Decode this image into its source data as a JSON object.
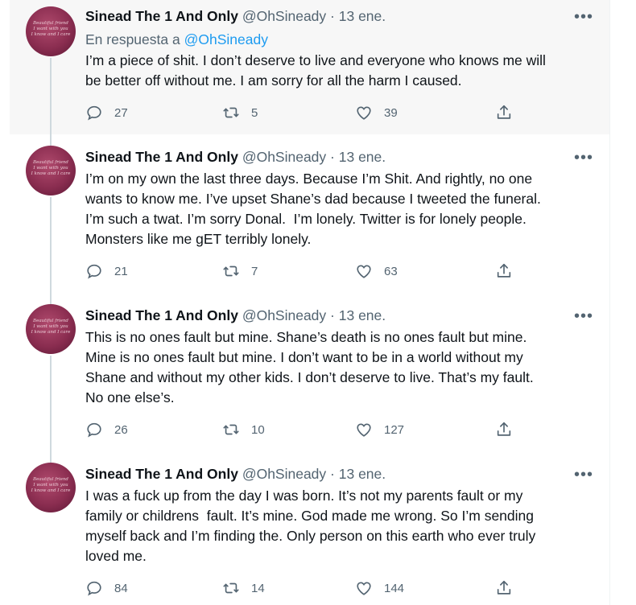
{
  "tweets": [
    {
      "name": "Sinead The 1 And Only",
      "handle": "@OhSineady",
      "separator": "·",
      "date": "13 ene.",
      "more": "•••",
      "reply_prefix": "En respuesta a",
      "reply_handle": "@OhSineady",
      "text": "I’m a piece of shit. I don’t deserve to live and everyone who knows me will\nbe better off without me. I am sorry for all the harm I caused.",
      "replies": "27",
      "retweets": "5",
      "likes": "39",
      "avatar_text": "Beautiful friend\nI want with you\nI know and I care"
    },
    {
      "name": "Sinead The 1 And Only",
      "handle": "@OhSineady",
      "separator": "·",
      "date": "13 ene.",
      "more": "•••",
      "text": "I’m on my own the last three days. Because I’m Shit. And rightly, no one\nwants to know me. I’ve upset Shane’s dad because I tweeted the funeral.\nI’m such a twat. I’m sorry Donal.  I’m lonely. Twitter is for lonely people.\nMonsters like me gET terribly lonely.",
      "replies": "21",
      "retweets": "7",
      "likes": "63",
      "avatar_text": "Beautiful friend\nI want with you\nI know and I care"
    },
    {
      "name": "Sinead The 1 And Only",
      "handle": "@OhSineady",
      "separator": "·",
      "date": "13 ene.",
      "more": "•••",
      "text": "This is no ones fault but mine. Shane’s death is no ones fault but mine.\nMine is no ones fault but mine. I don’t want to be in a world without my\nShane and without my other kids. I don’t deserve to live. That’s my fault.\nNo one else’s.",
      "replies": "26",
      "retweets": "10",
      "likes": "127",
      "avatar_text": "Beautiful friend\nI want with you\nI know and I care"
    },
    {
      "name": "Sinead The 1 And Only",
      "handle": "@OhSineady",
      "separator": "·",
      "date": "13 ene.",
      "more": "•••",
      "text": "I was a fuck up from the day I was born. It’s not my parents fault or my\nfamily or childrens  fault. It’s mine. God made me wrong. So I’m sending\nmyself back and I’m finding the. Only person on this earth who ever truly\nloved me.",
      "replies": "84",
      "retweets": "14",
      "likes": "144",
      "avatar_text": "Beautiful friend\nI want with you\nI know and I care"
    }
  ],
  "colors": {
    "link": "#1d9bf0",
    "muted": "#536471",
    "text": "#0f1419",
    "highlight_bg": "#f7f7f7"
  },
  "icons": [
    "reply-icon",
    "retweet-icon",
    "like-icon",
    "share-icon",
    "more-icon"
  ]
}
